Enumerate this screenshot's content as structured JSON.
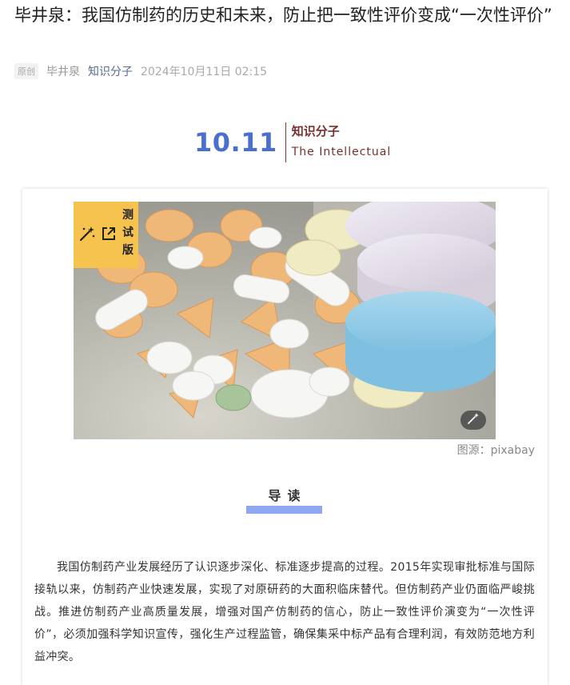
{
  "article": {
    "title": "毕井泉：我国仿制药的历史和未来，防止把一致性评价变成“一次性评价”",
    "original_badge": "原创",
    "author": "毕井泉",
    "account": "知识分子",
    "datetime": "2024年10月11日 02:15"
  },
  "header": {
    "date": "10.11",
    "brand_cn": "知识分子",
    "brand_en": "The Intellectual"
  },
  "image": {
    "badge_label": "测试版",
    "caption": "图源：pixabay"
  },
  "section": {
    "guide_title": "导读"
  },
  "body": {
    "paragraph": "我国仿制药产业发展经历了认识逐步深化、标准逐步提高的过程。2015年实现审批标准与国际接轨以来，仿制药产业快速发展，实现了对原研药的大面积临床替代。但仿制药产业仍面临严峻挑战。推进仿制药产业高质量发展，增强对国产仿制药的信心，防止一致性评价演变为“一次性评价”，必须加强科学知识宣传，强化生产过程监管，确保集采中标产品有合理利润，有效防范地方利益冲突。"
  },
  "colors": {
    "accent_blue": "#4a6fcf",
    "brand_brown": "#7a2f2f",
    "badge_yellow": "#f7c34f",
    "guide_bar": "#8ea7ee",
    "link": "#576b95"
  }
}
